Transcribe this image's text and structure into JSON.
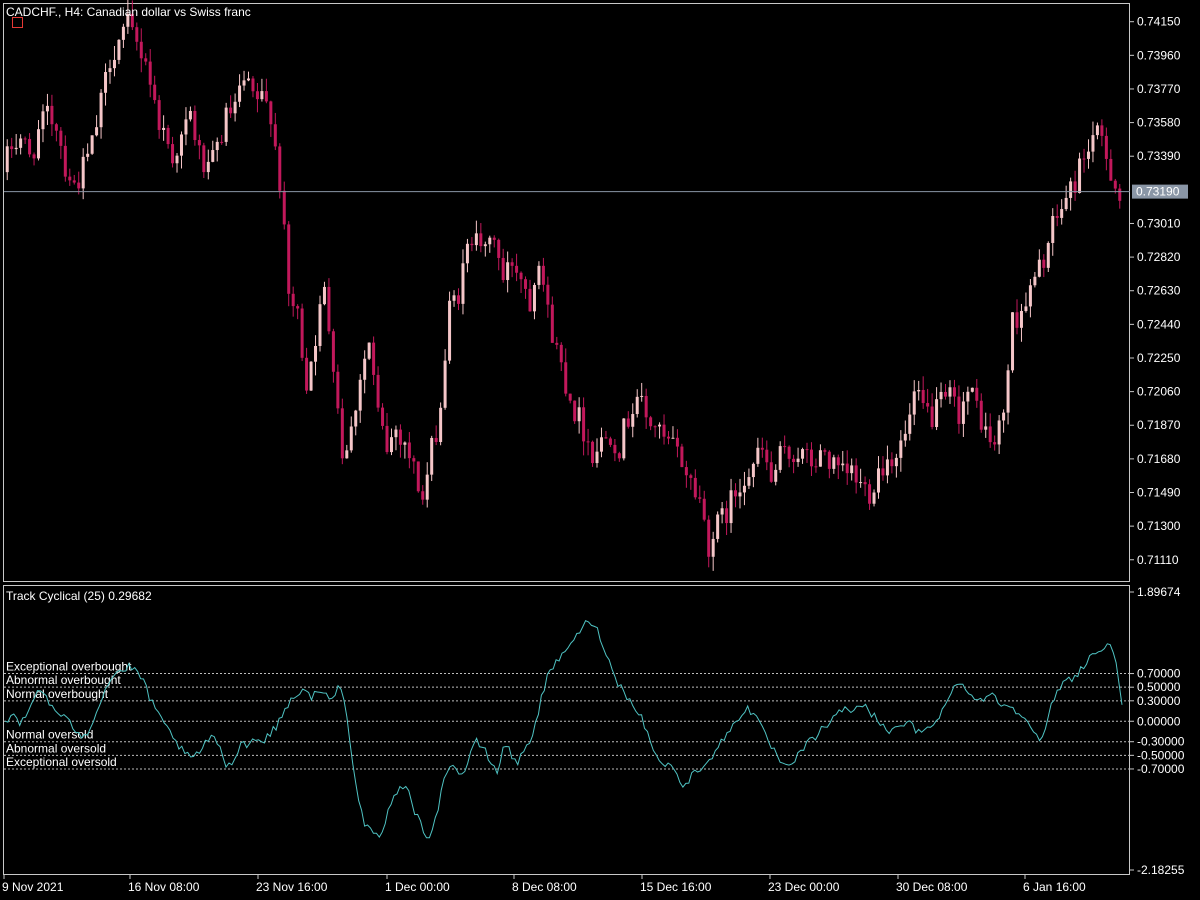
{
  "chart": {
    "symbol_title": "CADCHF., H4:  Canadian dollar vs Swiss franc",
    "current_price_label": "0.73190",
    "current_price": 0.7319
  },
  "indicator": {
    "title": "Track Cyclical (25) 0.29682",
    "top_label": "1.89674",
    "bottom_label": "-2.18255",
    "levels": [
      {
        "label": "Exceptional overbought",
        "value": 0.7,
        "tick": "0.70000"
      },
      {
        "label": "Abnormal overbought",
        "value": 0.5,
        "tick": "0.50000"
      },
      {
        "label": "Normal overbought",
        "value": 0.3,
        "tick": "0.30000"
      },
      {
        "label": "",
        "value": 0.0,
        "tick": "0.00000"
      },
      {
        "label": "Normal oversold",
        "value": -0.3,
        "tick": "-0.30000"
      },
      {
        "label": "Abnormal oversold",
        "value": -0.5,
        "tick": "-0.50000"
      },
      {
        "label": "Exceptional oversold",
        "value": -0.7,
        "tick": "-0.70000"
      }
    ]
  },
  "colors": {
    "background": "#000000",
    "frame": "#c8c8c8",
    "bull_candle": "#f5c6c8",
    "bear_candle": "#c2185b",
    "indicator_line": "#4fc3c3",
    "price_line": "#8a96a6",
    "price_label_bg": "#8a96a6"
  },
  "chart_data": [
    {
      "type": "candlestick",
      "title": "CADCHF., H4:  Canadian dollar vs Swiss franc",
      "ylim": [
        0.7099,
        0.7425
      ],
      "y_ticks": [
        "0.74150",
        "0.73960",
        "0.73770",
        "0.73580",
        "0.73390",
        "0.73010",
        "0.72820",
        "0.72630",
        "0.72440",
        "0.72250",
        "0.72060",
        "0.71870",
        "0.71680",
        "0.71490",
        "0.71300",
        "0.71110"
      ],
      "x_ticks": [
        "9 Nov 2021",
        "16 Nov 08:00",
        "23 Nov 16:00",
        "1 Dec 00:00",
        "8 Dec 08:00",
        "15 Dec 16:00",
        "23 Dec 00:00",
        "30 Dec 08:00",
        "6 Jan 16:00"
      ],
      "close_path": [
        0.733,
        0.7345,
        0.735,
        0.7338,
        0.7352,
        0.7362,
        0.7358,
        0.7334,
        0.7322,
        0.7332,
        0.7345,
        0.7368,
        0.7395,
        0.7405,
        0.7412,
        0.7402,
        0.7395,
        0.7368,
        0.7352,
        0.734,
        0.7348,
        0.7362,
        0.734,
        0.7328,
        0.7344,
        0.736,
        0.7366,
        0.738,
        0.7372,
        0.737,
        0.7365,
        0.7325,
        0.726,
        0.7248,
        0.7212,
        0.7238,
        0.7262,
        0.7225,
        0.7172,
        0.7184,
        0.7216,
        0.7233,
        0.7192,
        0.7174,
        0.7185,
        0.7178,
        0.7162,
        0.7145,
        0.7172,
        0.7198,
        0.7252,
        0.7262,
        0.7285,
        0.7303,
        0.7282,
        0.7295,
        0.7268,
        0.728,
        0.7273,
        0.7258,
        0.7285,
        0.725,
        0.723,
        0.7212,
        0.7196,
        0.7185,
        0.7172,
        0.7178,
        0.7183,
        0.7175,
        0.7192,
        0.7205,
        0.719,
        0.7187,
        0.7177,
        0.7175,
        0.7167,
        0.7155,
        0.7145,
        0.712,
        0.713,
        0.7138,
        0.7149,
        0.716,
        0.7165,
        0.7172,
        0.7155,
        0.7168,
        0.717,
        0.7172,
        0.7167,
        0.7165,
        0.7172,
        0.7162,
        0.7158,
        0.716,
        0.7153,
        0.715,
        0.7162,
        0.7168,
        0.7172,
        0.718,
        0.7202,
        0.7196,
        0.7192,
        0.7198,
        0.7202,
        0.7195,
        0.7205,
        0.7198,
        0.7183,
        0.7175,
        0.7195,
        0.7245,
        0.7253,
        0.7262,
        0.7275,
        0.729,
        0.7305,
        0.7315,
        0.7325,
        0.734,
        0.735,
        0.7347,
        0.7332,
        0.7315
      ],
      "current_price": 0.7319
    },
    {
      "type": "line",
      "title": "Track Cyclical (25) 0.29682",
      "ylim": [
        -2.18255,
        1.89674
      ],
      "y_ticks": [
        "1.89674",
        "0.70000",
        "0.50000",
        "0.30000",
        "0.00000",
        "-0.30000",
        "-0.50000",
        "-0.70000",
        "-2.18255"
      ],
      "levels": [
        0.7,
        0.5,
        0.3,
        0.0,
        -0.3,
        -0.5,
        -0.7
      ],
      "values": [
        0.0,
        0.1,
        -0.05,
        0.05,
        0.3,
        0.5,
        0.35,
        0.15,
        0.1,
        0.0,
        -0.1,
        -0.2,
        -0.15,
        0.1,
        0.35,
        0.6,
        0.7,
        0.75,
        0.8,
        0.7,
        0.6,
        0.3,
        0.1,
        -0.05,
        -0.2,
        -0.35,
        -0.5,
        -0.55,
        -0.45,
        -0.3,
        -0.25,
        -0.35,
        -0.7,
        -0.55,
        -0.3,
        -0.35,
        -0.25,
        -0.3,
        -0.2,
        -0.1,
        0.1,
        0.3,
        0.4,
        0.45,
        0.35,
        0.45,
        0.4,
        0.3,
        0.5,
        0.35,
        -0.5,
        -1.2,
        -1.55,
        -1.65,
        -1.75,
        -1.4,
        -1.15,
        -0.9,
        -1.0,
        -1.3,
        -1.55,
        -1.7,
        -1.45,
        -1.0,
        -0.6,
        -0.7,
        -0.8,
        -0.5,
        -0.3,
        -0.4,
        -0.6,
        -0.75,
        -0.3,
        -0.5,
        -0.6,
        -0.4,
        -0.2,
        0.2,
        0.6,
        0.8,
        0.9,
        1.1,
        1.2,
        1.3,
        1.5,
        1.4,
        1.2,
        0.9,
        0.6,
        0.5,
        0.3,
        0.2,
        0.0,
        -0.3,
        -0.5,
        -0.7,
        -0.6,
        -0.85,
        -0.95,
        -0.8,
        -0.7,
        -0.6,
        -0.5,
        -0.35,
        -0.2,
        -0.05,
        0.1,
        0.2,
        0.1,
        -0.1,
        -0.3,
        -0.45,
        -0.65,
        -0.7,
        -0.55,
        -0.4,
        -0.3,
        -0.2,
        -0.1,
        0.0,
        0.1,
        0.2,
        0.15,
        0.25,
        0.2,
        0.1,
        0.0,
        -0.1,
        -0.15,
        -0.1,
        0.0,
        -0.1,
        -0.2,
        -0.1,
        0.0,
        0.15,
        0.3,
        0.55,
        0.6,
        0.4,
        0.3,
        0.35,
        0.4,
        0.3,
        0.25,
        0.2,
        0.15,
        0.1,
        -0.1,
        -0.3,
        -0.15,
        0.3,
        0.5,
        0.6,
        0.65,
        0.75,
        0.9,
        1.0,
        1.05,
        1.1,
        1.0,
        0.3
      ]
    }
  ]
}
